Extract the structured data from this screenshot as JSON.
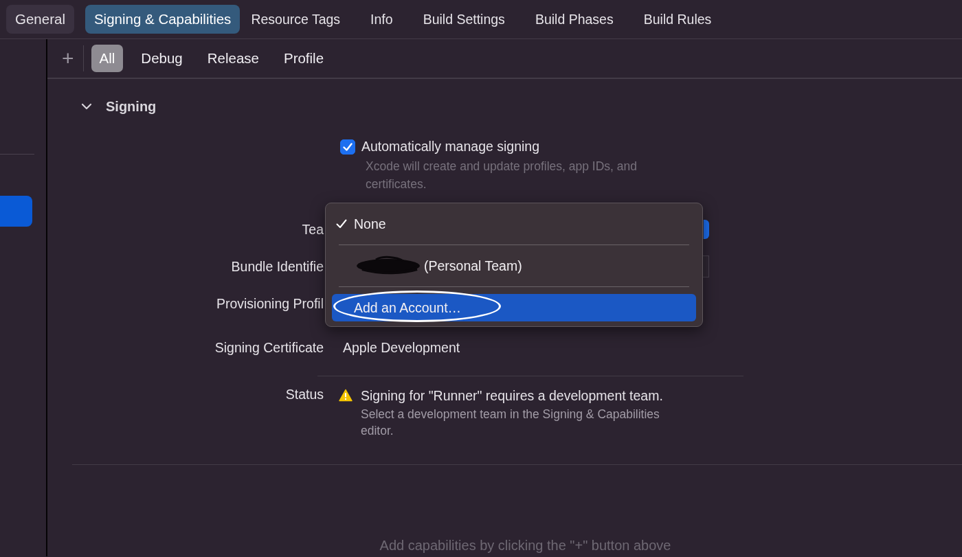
{
  "tabs": [
    {
      "label": "General",
      "selected": false,
      "kind": "chip"
    },
    {
      "label": "Signing & Capabilities",
      "selected": true,
      "kind": "chip"
    },
    {
      "label": "Resource Tags",
      "selected": false,
      "kind": "plain"
    },
    {
      "label": "Info",
      "selected": false,
      "kind": "plain"
    },
    {
      "label": "Build Settings",
      "selected": false,
      "kind": "plain"
    },
    {
      "label": "Build Phases",
      "selected": false,
      "kind": "plain"
    },
    {
      "label": "Build Rules",
      "selected": false,
      "kind": "plain"
    }
  ],
  "sidebar": {
    "items": [
      {
        "selected": true
      }
    ]
  },
  "config_bar": {
    "add_button": "+",
    "filters": [
      {
        "label": "All",
        "selected": true
      },
      {
        "label": "Debug",
        "selected": false
      },
      {
        "label": "Release",
        "selected": false
      },
      {
        "label": "Profile",
        "selected": false
      }
    ]
  },
  "signing": {
    "title": "Signing",
    "expanded": true,
    "auto_manage": {
      "label": "Automatically manage signing",
      "checked": true,
      "hint": "Xcode will create and update profiles, app IDs, and certificates."
    },
    "fields": [
      {
        "label": "Tea",
        "kind": "popup"
      },
      {
        "label": "Bundle Identifie",
        "kind": "text"
      },
      {
        "label": "Provisioning Profil",
        "kind": "none"
      },
      {
        "label": "Signing Certificate",
        "kind": "plain",
        "value": "Apple Development"
      }
    ],
    "status": {
      "label": "Status",
      "kind": "warning",
      "message": "Signing for \"Runner\" requires a development team.",
      "detail": "Select a development team in the Signing & Capabilities editor."
    }
  },
  "team_menu": {
    "items": [
      {
        "kind": "option",
        "label": "None",
        "selected": true,
        "redacted": false
      },
      {
        "kind": "option",
        "label": "(Personal Team)",
        "selected": false,
        "redacted": true
      },
      {
        "kind": "action",
        "label": "Add an Account…",
        "highlighted": true,
        "circled": true
      }
    ]
  },
  "capabilities_hint": "Add capabilities by clicking the \"+\" button above"
}
